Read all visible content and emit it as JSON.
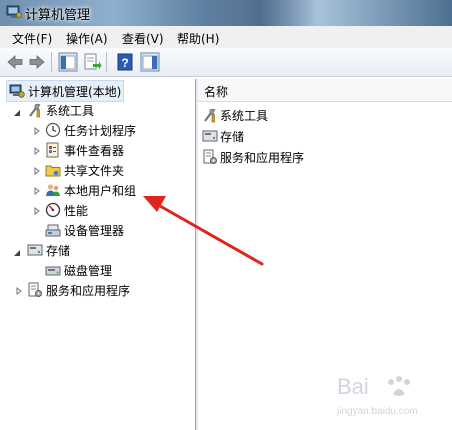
{
  "window": {
    "title": "计算机管理"
  },
  "menu": [
    "文件(F)",
    "操作(A)",
    "查看(V)",
    "帮助(H)"
  ],
  "tree": {
    "root": "计算机管理(本地)",
    "system_tools": "系统工具",
    "task_scheduler": "任务计划程序",
    "event_viewer": "事件查看器",
    "shared_folders": "共享文件夹",
    "local_users": "本地用户和组",
    "performance": "性能",
    "device_manager": "设备管理器",
    "storage": "存储",
    "disk_management": "磁盘管理",
    "services_apps": "服务和应用程序"
  },
  "list": {
    "column_name": "名称",
    "items": [
      "系统工具",
      "存储",
      "服务和应用程序"
    ]
  },
  "watermark": {
    "brand": "Bai",
    "sub": "jingyan.baidu.com"
  },
  "colors": {
    "annotation_arrow": "#e0241c"
  }
}
